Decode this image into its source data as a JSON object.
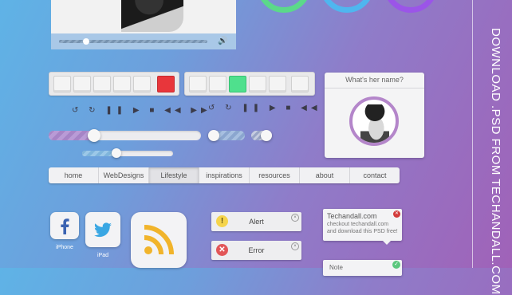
{
  "video": {
    "volume_icon": "🔊"
  },
  "circles": [
    {
      "color": "#5bd98a"
    },
    {
      "color": "#4fb6ef"
    },
    {
      "color": "#9b55e8"
    }
  ],
  "media_controls": "↺ ↻ ❚❚ ▶ ■ ◀◀ ▶▶",
  "profile": {
    "title": "What's her name?"
  },
  "nav": {
    "items": [
      "home",
      "WebDesigns",
      "Lifestyle",
      "inspirations",
      "resources",
      "about",
      "contact"
    ],
    "active_index": 2
  },
  "sliders": {
    "main_progress": 0.3,
    "small_progress": 0.38
  },
  "apps": [
    {
      "label": "iPhone",
      "icon": "facebook-icon"
    },
    {
      "label": "iPad",
      "icon": "twitter-icon"
    },
    {
      "label": "",
      "icon": "rss-icon"
    }
  ],
  "alerts": [
    {
      "label": "Alert",
      "icon": "!"
    },
    {
      "label": "Error",
      "icon": "✕"
    }
  ],
  "tooltip": {
    "title": "Techandall.com",
    "body": "checkout techandall.com and download this PSD free!"
  },
  "note": {
    "label": "Note"
  },
  "sidebar": {
    "text": "DOWNLOAD .PSD FROM TECHANDALL.COM"
  }
}
